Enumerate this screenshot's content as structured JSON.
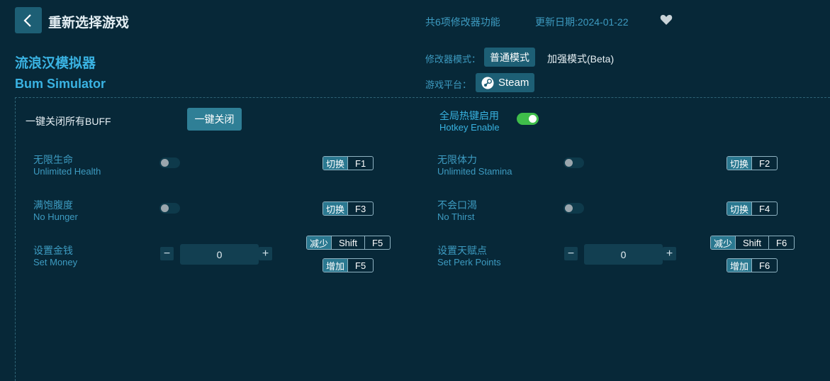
{
  "header": {
    "title": "重新选择游戏",
    "feature_count": "共6项修改器功能",
    "update_date": "更新日期:2024-01-22"
  },
  "game": {
    "name_cn": "流浪汉模拟器",
    "name_en": "Bum Simulator"
  },
  "mode": {
    "label": "修改器模式：",
    "normal": "普通模式",
    "enhanced": "加强模式(Beta)"
  },
  "platform": {
    "label": "游戏平台：",
    "name": "Steam"
  },
  "controls": {
    "close_all_label": "一键关闭所有BUFF",
    "close_all_button": "一键关闭",
    "hotkey_cn": "全局热键启用",
    "hotkey_en": "Hotkey Enable",
    "hotkey_enabled": true
  },
  "cheats": [
    {
      "cn": "无限生命",
      "en": "Unlimited Health",
      "tag": "切换",
      "key": "F1",
      "on": false
    },
    {
      "cn": "无限体力",
      "en": "Unlimited Stamina",
      "tag": "切换",
      "key": "F2",
      "on": false
    },
    {
      "cn": "满饱腹度",
      "en": "No Hunger",
      "tag": "切换",
      "key": "F3",
      "on": false
    },
    {
      "cn": "不会口渴",
      "en": "No Thirst",
      "tag": "切换",
      "key": "F4",
      "on": false
    }
  ],
  "setters": [
    {
      "cn": "设置金钱",
      "en": "Set Money",
      "value": "0",
      "dec_tag": "减少",
      "dec_mod": "Shift",
      "dec_key": "F5",
      "inc_tag": "增加",
      "inc_key": "F5",
      "minus": "−",
      "plus": "+"
    },
    {
      "cn": "设置天赋点",
      "en": "Set Perk Points",
      "value": "0",
      "dec_tag": "减少",
      "dec_mod": "Shift",
      "dec_key": "F6",
      "inc_tag": "增加",
      "inc_key": "F6",
      "minus": "−",
      "plus": "+"
    }
  ],
  "icons": {
    "back": "chevron-left-icon",
    "favorite": "heart-icon",
    "platform": "steam-icon"
  },
  "colors": {
    "background": "#072838",
    "accent": "#1d5f75",
    "text_blue": "#3d9bc1",
    "toggle_on": "#3fbd4a"
  }
}
